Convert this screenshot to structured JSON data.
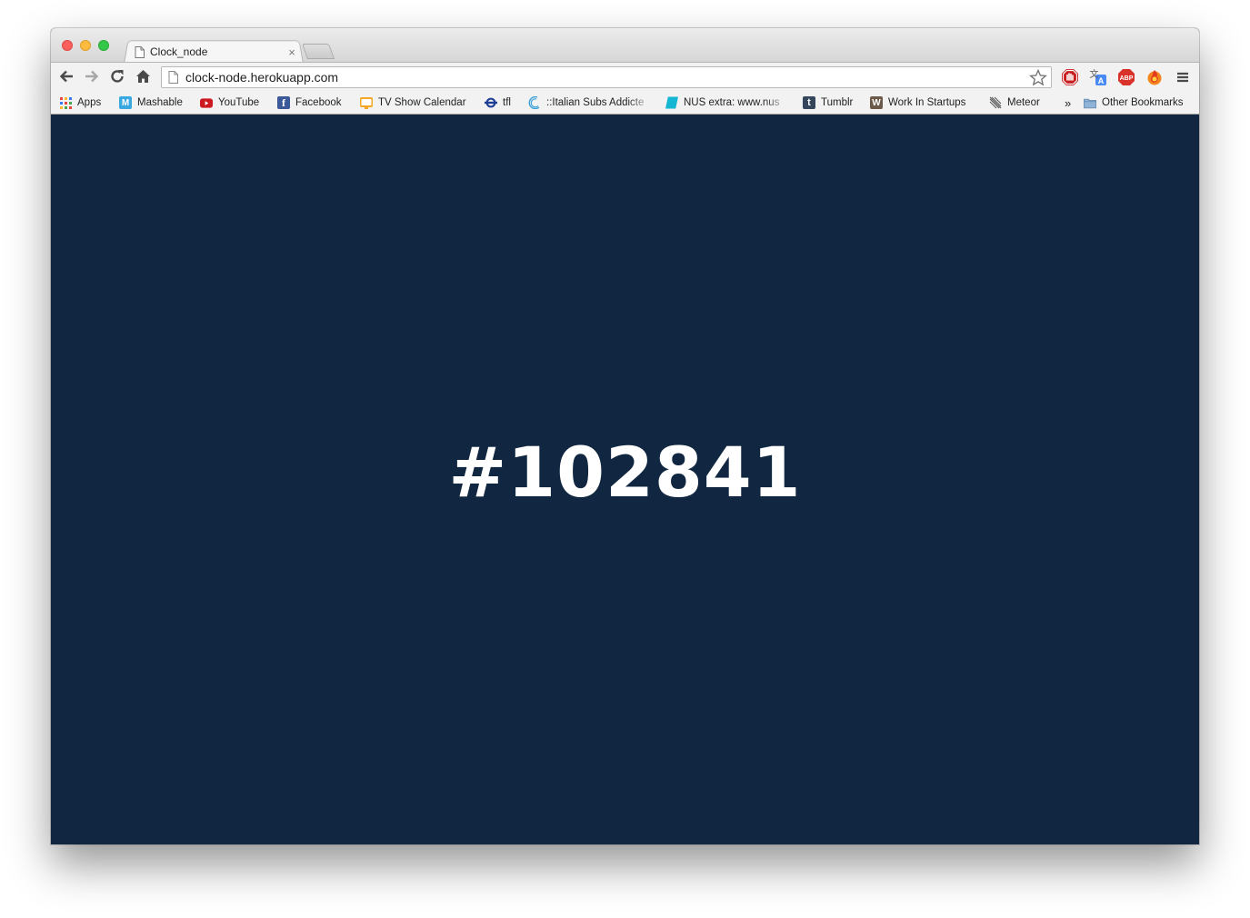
{
  "window": {
    "background_color": "#112741"
  },
  "tab": {
    "title": "Clock_node",
    "close_glyph": "×"
  },
  "toolbar": {
    "url": "clock-node.herokuapp.com",
    "icons": [
      "back-icon",
      "forward-icon",
      "reload-icon",
      "home-icon",
      "star-icon",
      "stop-extension-icon",
      "translate-icon",
      "adblock-icon",
      "firefox-icon",
      "menu-icon"
    ],
    "adblock_label": "ABP"
  },
  "bookmarks": {
    "items": [
      {
        "label": "Apps",
        "icon": "apps-grid-icon"
      },
      {
        "label": "Mashable",
        "icon": "mashable-icon",
        "glyph": "M",
        "color": "#3aa8e0"
      },
      {
        "label": "YouTube",
        "icon": "youtube-icon",
        "color": "#cc181e"
      },
      {
        "label": "Facebook",
        "icon": "facebook-icon",
        "glyph": "f",
        "color": "#3b5998"
      },
      {
        "label": "TV Show Calendar",
        "icon": "tv-calendar-icon",
        "color": "#f5a623"
      },
      {
        "label": "tfl",
        "icon": "tfl-roundel-icon",
        "color": "#1c3f94"
      },
      {
        "label": "::Italian Subs Addicte",
        "icon": "italian-subs-icon",
        "color": "#3aa0d8"
      },
      {
        "label": "NUS extra: www.nus",
        "icon": "nus-extra-icon",
        "color": "#14b6d4"
      },
      {
        "label": "Tumblr",
        "icon": "tumblr-icon",
        "glyph": "t",
        "color": "#35465c"
      },
      {
        "label": "Work In Startups",
        "icon": "work-in-startups-icon",
        "glyph": "W",
        "color": "#6b5a4a"
      },
      {
        "label": "Meteor",
        "icon": "meteor-icon",
        "color": "#555555"
      }
    ],
    "overflow": "»",
    "other_label": "Other Bookmarks"
  },
  "page": {
    "color_code": "#102841",
    "text_color": "#ffffff"
  }
}
